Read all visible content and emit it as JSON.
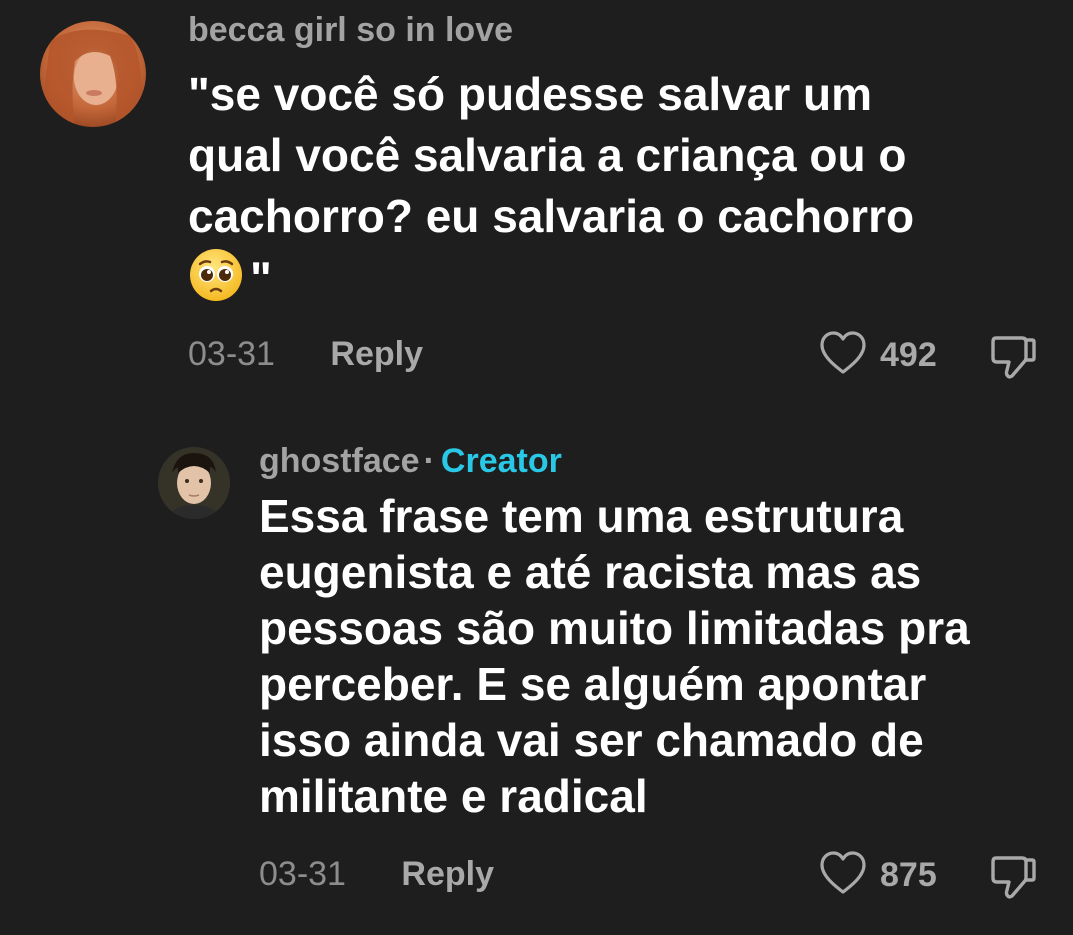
{
  "comments": [
    {
      "username": "becca girl so in love",
      "text_lines": [
        "\"se você só pudesse salvar um",
        "qual você salvaria a criança ou o",
        "cachorro? eu salvaria o cachorro"
      ],
      "last_line_suffix": "\"",
      "emoji": "pleading-face",
      "date": "03-31",
      "reply_label": "Reply",
      "likes": "492"
    },
    {
      "username": "ghostface",
      "separator": "·",
      "badge": "Creator",
      "text_lines": [
        "Essa frase tem uma estrutura",
        "eugenista e até racista mas as",
        "pessoas são muito limitadas pra",
        "perceber. E se alguém apontar",
        "isso ainda vai ser chamado de",
        "militante e radical"
      ],
      "date": "03-31",
      "reply_label": "Reply",
      "likes": "875"
    }
  ],
  "colors": {
    "background": "#1e1e1e",
    "username": "#a3a3a3",
    "creator_badge": "#29c8e6",
    "text": "#ffffff",
    "meta": "#9a9a9a"
  },
  "icons": {
    "like": "heart-outline-icon",
    "dislike": "thumbs-down-outline-icon"
  }
}
